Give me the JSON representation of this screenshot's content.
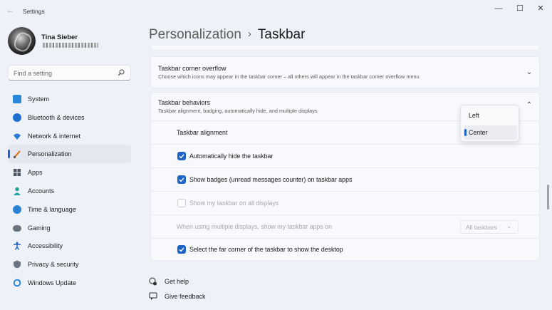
{
  "window": {
    "title": "Settings",
    "back_icon": "arrow-left-icon",
    "controls": {
      "minimize": "—",
      "maximize": "☐",
      "close": "✕"
    }
  },
  "user": {
    "name": "Tina Sieber"
  },
  "search": {
    "placeholder": "Find a setting",
    "value": "",
    "icon": "search-icon"
  },
  "sidebar": {
    "items": [
      {
        "label": "System",
        "icon": "monitor-icon",
        "color": "#2b88d8",
        "selected": false
      },
      {
        "label": "Bluetooth & devices",
        "icon": "bluetooth-icon",
        "color": "#1e6fd0",
        "selected": false
      },
      {
        "label": "Network & internet",
        "icon": "wifi-icon",
        "color": "#2a7bd6",
        "selected": false
      },
      {
        "label": "Personalization",
        "icon": "brush-icon",
        "color": "#d87a1e",
        "selected": true
      },
      {
        "label": "Apps",
        "icon": "apps-icon",
        "color": "#4b5563",
        "selected": false
      },
      {
        "label": "Accounts",
        "icon": "person-icon",
        "color": "#21a0a0",
        "selected": false
      },
      {
        "label": "Time & language",
        "icon": "globe-clock-icon",
        "color": "#2a82d2",
        "selected": false
      },
      {
        "label": "Gaming",
        "icon": "controller-icon",
        "color": "#6b7280",
        "selected": false
      },
      {
        "label": "Accessibility",
        "icon": "accessibility-icon",
        "color": "#1f63c8",
        "selected": false
      },
      {
        "label": "Privacy & security",
        "icon": "shield-icon",
        "color": "#6b7280",
        "selected": false
      },
      {
        "label": "Windows Update",
        "icon": "update-icon",
        "color": "#1f7fd4",
        "selected": false
      }
    ]
  },
  "header": {
    "breadcrumb_parent": "Personalization",
    "separator": "›",
    "breadcrumb_current": "Taskbar"
  },
  "corner_overflow": {
    "title": "Taskbar corner overflow",
    "subtitle": "Choose which icons may appear in the taskbar corner – all others will appear in the taskbar corner overflow menu",
    "expanded": false
  },
  "behaviors": {
    "title": "Taskbar behaviors",
    "subtitle": "Taskbar alignment, badging, automatically hide, and multiple displays",
    "expanded": true,
    "alignment": {
      "label": "Taskbar alignment",
      "options": [
        "Left",
        "Center"
      ],
      "selected": "Center"
    },
    "settings": [
      {
        "label": "Automatically hide the taskbar",
        "checked": true,
        "enabled": true
      },
      {
        "label": "Show badges (unread messages counter) on taskbar apps",
        "checked": true,
        "enabled": true
      },
      {
        "label": "Show my taskbar on all displays",
        "checked": false,
        "enabled": false
      }
    ],
    "multi_display": {
      "label": "When using multiple displays, show my taskbar apps on",
      "value": "All taskbars",
      "enabled": false
    },
    "far_corner": {
      "label": "Select the far corner of the taskbar to show the desktop",
      "checked": true,
      "enabled": true
    }
  },
  "help_links": {
    "get_help": "Get help",
    "give_feedback": "Give feedback"
  },
  "colors": {
    "accent": "#1f63c8",
    "background": "#eef1f8",
    "card": "#f8f9fc"
  }
}
